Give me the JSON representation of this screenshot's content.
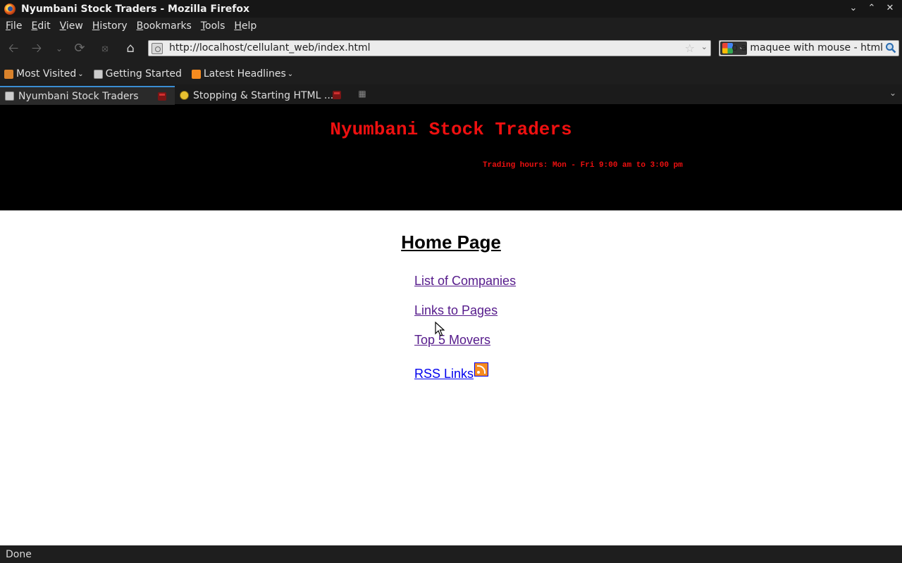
{
  "window": {
    "title": "Nyumbani Stock Traders - Mozilla Firefox",
    "controls": [
      "minimize",
      "maximize",
      "close"
    ]
  },
  "menubar": {
    "items": [
      {
        "mnemonic": "F",
        "rest": "ile"
      },
      {
        "mnemonic": "E",
        "rest": "dit"
      },
      {
        "mnemonic": "V",
        "rest": "iew"
      },
      {
        "mnemonic": "H",
        "rest": "istory"
      },
      {
        "mnemonic": "B",
        "rest": "ookmarks"
      },
      {
        "mnemonic": "T",
        "rest": "ools"
      },
      {
        "mnemonic": "H",
        "rest": "elp"
      }
    ]
  },
  "toolbar": {
    "url": "http://localhost/cellulant_web/index.html",
    "search_query": "o a maquee with mouse - html",
    "search_engine_icon": "google-icon",
    "buttons": [
      "back-icon",
      "forward-icon",
      "history-dropdown-icon",
      "reload-icon",
      "stop-icon",
      "home-icon"
    ]
  },
  "bookmarks": {
    "items": [
      {
        "label": "Most Visited",
        "has_menu": true,
        "icon": "folder-rss-icon"
      },
      {
        "label": "Getting Started",
        "has_menu": false,
        "icon": "page-icon"
      },
      {
        "label": "Latest Headlines",
        "has_menu": true,
        "icon": "rss-icon"
      }
    ]
  },
  "tabs": [
    {
      "label": "Nyumbani Stock Traders",
      "active": true
    },
    {
      "label": "Stopping & Starting HTML ...",
      "active": false
    }
  ],
  "page": {
    "site_title": "Nyumbani Stock Traders",
    "marquee": "Trading hours: Mon - Fri 9:00 am to 3:00 pm",
    "heading": "Home Page",
    "links": {
      "companies": "List of Companies",
      "pages": "Links to Pages",
      "movers": "Top 5 Movers",
      "rss": "RSS Links"
    }
  },
  "status": {
    "text": "Done"
  },
  "colors": {
    "chrome_bg": "#1e1e1e",
    "banner_bg": "#000000",
    "banner_text": "#ee1010",
    "visited_link": "#551a8b",
    "link": "#0000ee"
  }
}
